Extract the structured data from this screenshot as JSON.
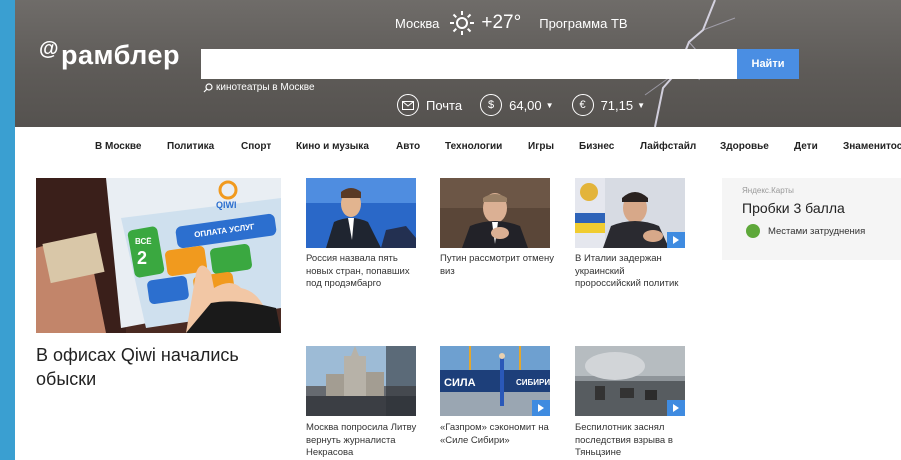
{
  "header": {
    "logo": "рамблер",
    "city": "Москва",
    "temperature": "+27°",
    "tv_link": "Программа ТВ",
    "search_value": "",
    "search_button": "Найти",
    "search_hint": "кинотеатры в Москве",
    "mail_label": "Почта",
    "usd_symbol": "$",
    "usd_rate": "64,00",
    "eur_symbol": "€",
    "eur_rate": "71,15"
  },
  "nav": {
    "items": [
      "В Москве",
      "Политика",
      "Спорт",
      "Кино и музыка",
      "Авто",
      "Технологии",
      "Игры",
      "Бизнес",
      "Лайфстайл",
      "Здоровье",
      "Дети",
      "Знаменитос"
    ]
  },
  "main": {
    "headline": "В офисах Qiwi начались обыски",
    "news": [
      {
        "caption": "Россия назвала пять новых стран, попавших под продэмбарго"
      },
      {
        "caption": "Путин рассмотрит отмену виз"
      },
      {
        "caption": "В Италии задержан украинский пророссийский политик"
      },
      {
        "caption": "Москва попросила Литву вернуть журналиста Некрасова"
      },
      {
        "caption": "«Газпром» сэкономит на «Силе Сибири»"
      },
      {
        "caption": "Беспилотник заснял последствия взрыва в Тяньцзине"
      }
    ]
  },
  "widget": {
    "source": "Яндекс.Карты",
    "title": "Пробки 3 балла",
    "status": "Местами затруднения"
  },
  "thumbs": {
    "qiwi_logo": "QIWI",
    "qiwi_pay": "ОПЛАТА УСЛУГ",
    "qiwi_all": "ВСЁ",
    "qiwi_2": "2",
    "sila_text": "СИЛА",
    "sibiri_text": "СИБИРИ"
  }
}
